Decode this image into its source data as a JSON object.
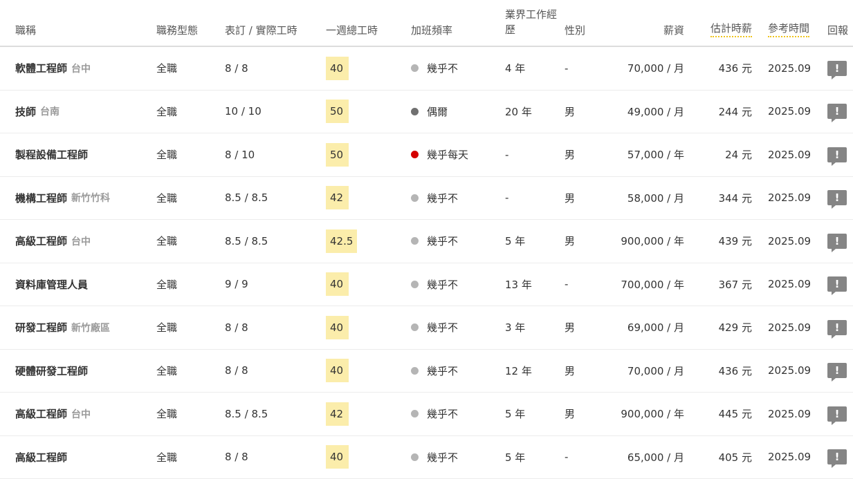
{
  "headers": {
    "title": "職稱",
    "type": "職務型態",
    "hours": "表訂 / 實際工時",
    "week": "一週總工時",
    "overtime": "加班頻率",
    "experience": "業界工作經歷",
    "gender": "性別",
    "salary": "薪資",
    "estimated": "估計時薪",
    "reference": "參考時間",
    "report": "回報"
  },
  "colors": {
    "week_highlight": "#fbedab",
    "dot_rarely": "#b5b5b5",
    "dot_sometimes": "#707070",
    "dot_daily": "#d40000",
    "report_icon": "#858585",
    "dotted_underline": "#f0c419"
  },
  "rows": [
    {
      "title": "軟體工程師",
      "location": "台中",
      "type": "全職",
      "hours": "8 / 8",
      "week": "40",
      "overtime": "幾乎不",
      "overtime_level": "rarely",
      "experience": "4 年",
      "gender": "-",
      "salary": "70,000 / 月",
      "estimated": "436 元",
      "reference": "2025.09",
      "report": "!"
    },
    {
      "title": "技師",
      "location": "台南",
      "type": "全職",
      "hours": "10 / 10",
      "week": "50",
      "overtime": "偶爾",
      "overtime_level": "sometimes",
      "experience": "20 年",
      "gender": "男",
      "salary": "49,000 / 月",
      "estimated": "244 元",
      "reference": "2025.09",
      "report": "!"
    },
    {
      "title": "製程設備工程師",
      "location": "",
      "type": "全職",
      "hours": "8 / 10",
      "week": "50",
      "overtime": "幾乎每天",
      "overtime_level": "daily",
      "experience": "-",
      "gender": "男",
      "salary": "57,000 / 年",
      "estimated": "24 元",
      "reference": "2025.09",
      "report": "!"
    },
    {
      "title": "機構工程師",
      "location": "新竹竹科",
      "type": "全職",
      "hours": "8.5 / 8.5",
      "week": "42",
      "overtime": "幾乎不",
      "overtime_level": "rarely",
      "experience": "-",
      "gender": "男",
      "salary": "58,000 / 月",
      "estimated": "344 元",
      "reference": "2025.09",
      "report": "!"
    },
    {
      "title": "高級工程師",
      "location": "台中",
      "type": "全職",
      "hours": "8.5 / 8.5",
      "week": "42.5",
      "overtime": "幾乎不",
      "overtime_level": "rarely",
      "experience": "5 年",
      "gender": "男",
      "salary": "900,000 / 年",
      "estimated": "439 元",
      "reference": "2025.09",
      "report": "!"
    },
    {
      "title": "資料庫管理人員",
      "location": "",
      "type": "全職",
      "hours": "9 / 9",
      "week": "40",
      "overtime": "幾乎不",
      "overtime_level": "rarely",
      "experience": "13 年",
      "gender": "-",
      "salary": "700,000 / 年",
      "estimated": "367 元",
      "reference": "2025.09",
      "report": "!"
    },
    {
      "title": "研發工程師",
      "location": "新竹廠區",
      "type": "全職",
      "hours": "8 / 8",
      "week": "40",
      "overtime": "幾乎不",
      "overtime_level": "rarely",
      "experience": "3 年",
      "gender": "男",
      "salary": "69,000 / 月",
      "estimated": "429 元",
      "reference": "2025.09",
      "report": "!"
    },
    {
      "title": "硬體研發工程師",
      "location": "",
      "type": "全職",
      "hours": "8 / 8",
      "week": "40",
      "overtime": "幾乎不",
      "overtime_level": "rarely",
      "experience": "12 年",
      "gender": "男",
      "salary": "70,000 / 月",
      "estimated": "436 元",
      "reference": "2025.09",
      "report": "!"
    },
    {
      "title": "高級工程師",
      "location": "台中",
      "type": "全職",
      "hours": "8.5 / 8.5",
      "week": "42",
      "overtime": "幾乎不",
      "overtime_level": "rarely",
      "experience": "5 年",
      "gender": "男",
      "salary": "900,000 / 年",
      "estimated": "445 元",
      "reference": "2025.09",
      "report": "!"
    },
    {
      "title": "高級工程師",
      "location": "",
      "type": "全職",
      "hours": "8 / 8",
      "week": "40",
      "overtime": "幾乎不",
      "overtime_level": "rarely",
      "experience": "5 年",
      "gender": "-",
      "salary": "65,000 / 月",
      "estimated": "405 元",
      "reference": "2025.09",
      "report": "!"
    }
  ]
}
